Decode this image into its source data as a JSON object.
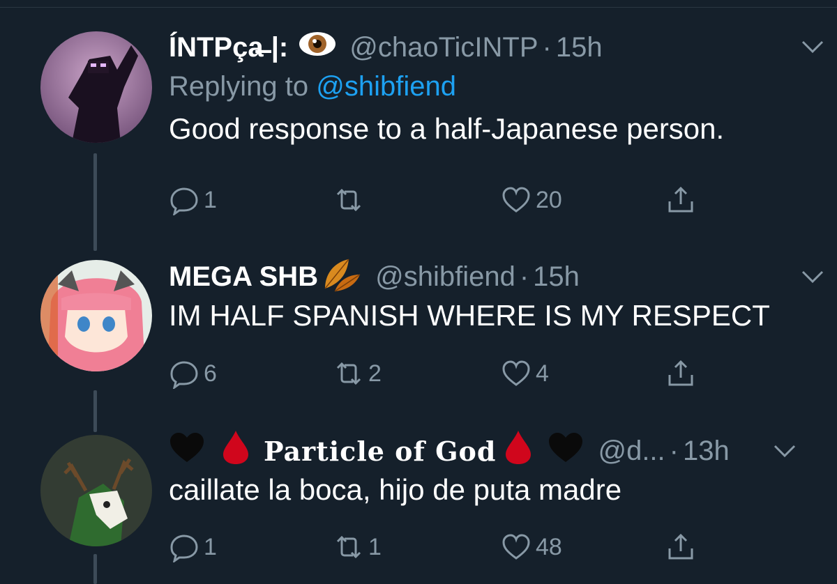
{
  "tweets": [
    {
      "display_name": "ÍNTPça̶ |:",
      "emoji": "eye",
      "handle": "@chaoTicINTP",
      "separator": "·",
      "time": "15h",
      "replying_prefix": "Replying to",
      "replying_to": "@shibfiend",
      "text": "Good response to a half-Japanese person.",
      "replies": "1",
      "retweets": "",
      "likes": "20"
    },
    {
      "display_name": "MEGA SHB",
      "emoji": "fallen-leaf",
      "handle": "@shibfiend",
      "separator": "·",
      "time": "15h",
      "text": "IM HALF SPANISH WHERE IS MY RESPECT",
      "replies": "6",
      "retweets": "2",
      "likes": "4"
    },
    {
      "display_name": "Particle of God",
      "emoji": "black-heart, drop-of-blood",
      "handle": "@d...",
      "separator": "·",
      "time": "13h",
      "text": "caillate la boca, hijo de puta madre",
      "replies": "1",
      "retweets": "1",
      "likes": "48"
    }
  ],
  "colors": {
    "background": "#15202b",
    "secondary_text": "#8899a6",
    "link": "#1da1f2",
    "thread_line": "#3d4b58"
  }
}
